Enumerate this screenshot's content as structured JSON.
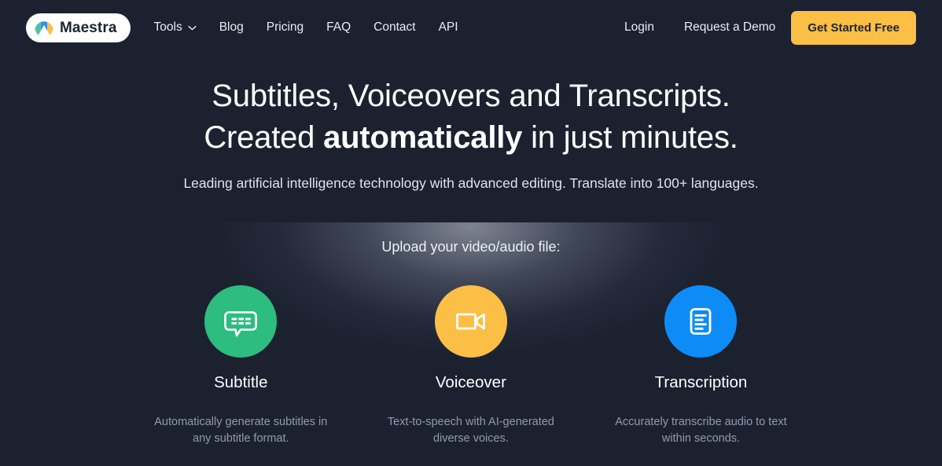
{
  "brand": {
    "name": "Maestra",
    "logo_icon": "maestra-mountain-logo-icon",
    "logo_colors": [
      "#4bc3a2",
      "#2f8fe8",
      "#fbbf45"
    ]
  },
  "nav": {
    "links": [
      {
        "label": "Tools",
        "icon": "chevron-down-icon",
        "has_caret": true
      },
      {
        "label": "Blog",
        "has_caret": false
      },
      {
        "label": "Pricing",
        "has_caret": false
      },
      {
        "label": "FAQ",
        "has_caret": false
      },
      {
        "label": "Contact",
        "has_caret": false
      },
      {
        "label": "API",
        "has_caret": false
      }
    ],
    "login_label": "Login",
    "demo_label": "Request a Demo",
    "cta_label": "Get Started Free",
    "cta_color": "#fbbf45"
  },
  "hero": {
    "headline_line1": "Subtitles, Voiceovers and Transcripts.",
    "headline_line2_pre": "Created ",
    "headline_line2_bold": "automatically",
    "headline_line2_post": " in just minutes.",
    "subheadline": "Leading artificial intelligence technology with advanced editing. Translate into 100+ languages."
  },
  "upload": {
    "label": "Upload your video/audio file:",
    "cards": [
      {
        "title": "Subtitle",
        "description": "Automatically generate subtitles in any subtitle format.",
        "icon": "speech-bubble-subtitle-icon",
        "color": "#2cbd7f"
      },
      {
        "title": "Voiceover",
        "description": "Text-to-speech with AI-generated diverse voices.",
        "icon": "video-camera-icon",
        "color": "#fbbf45"
      },
      {
        "title": "Transcription",
        "description": "Accurately transcribe audio to text within seconds.",
        "icon": "document-lines-icon",
        "color": "#0d8cf7"
      }
    ]
  },
  "theme": {
    "background": "#1c2130",
    "text_primary": "#ffffff",
    "text_muted": "#8f9bb0"
  }
}
